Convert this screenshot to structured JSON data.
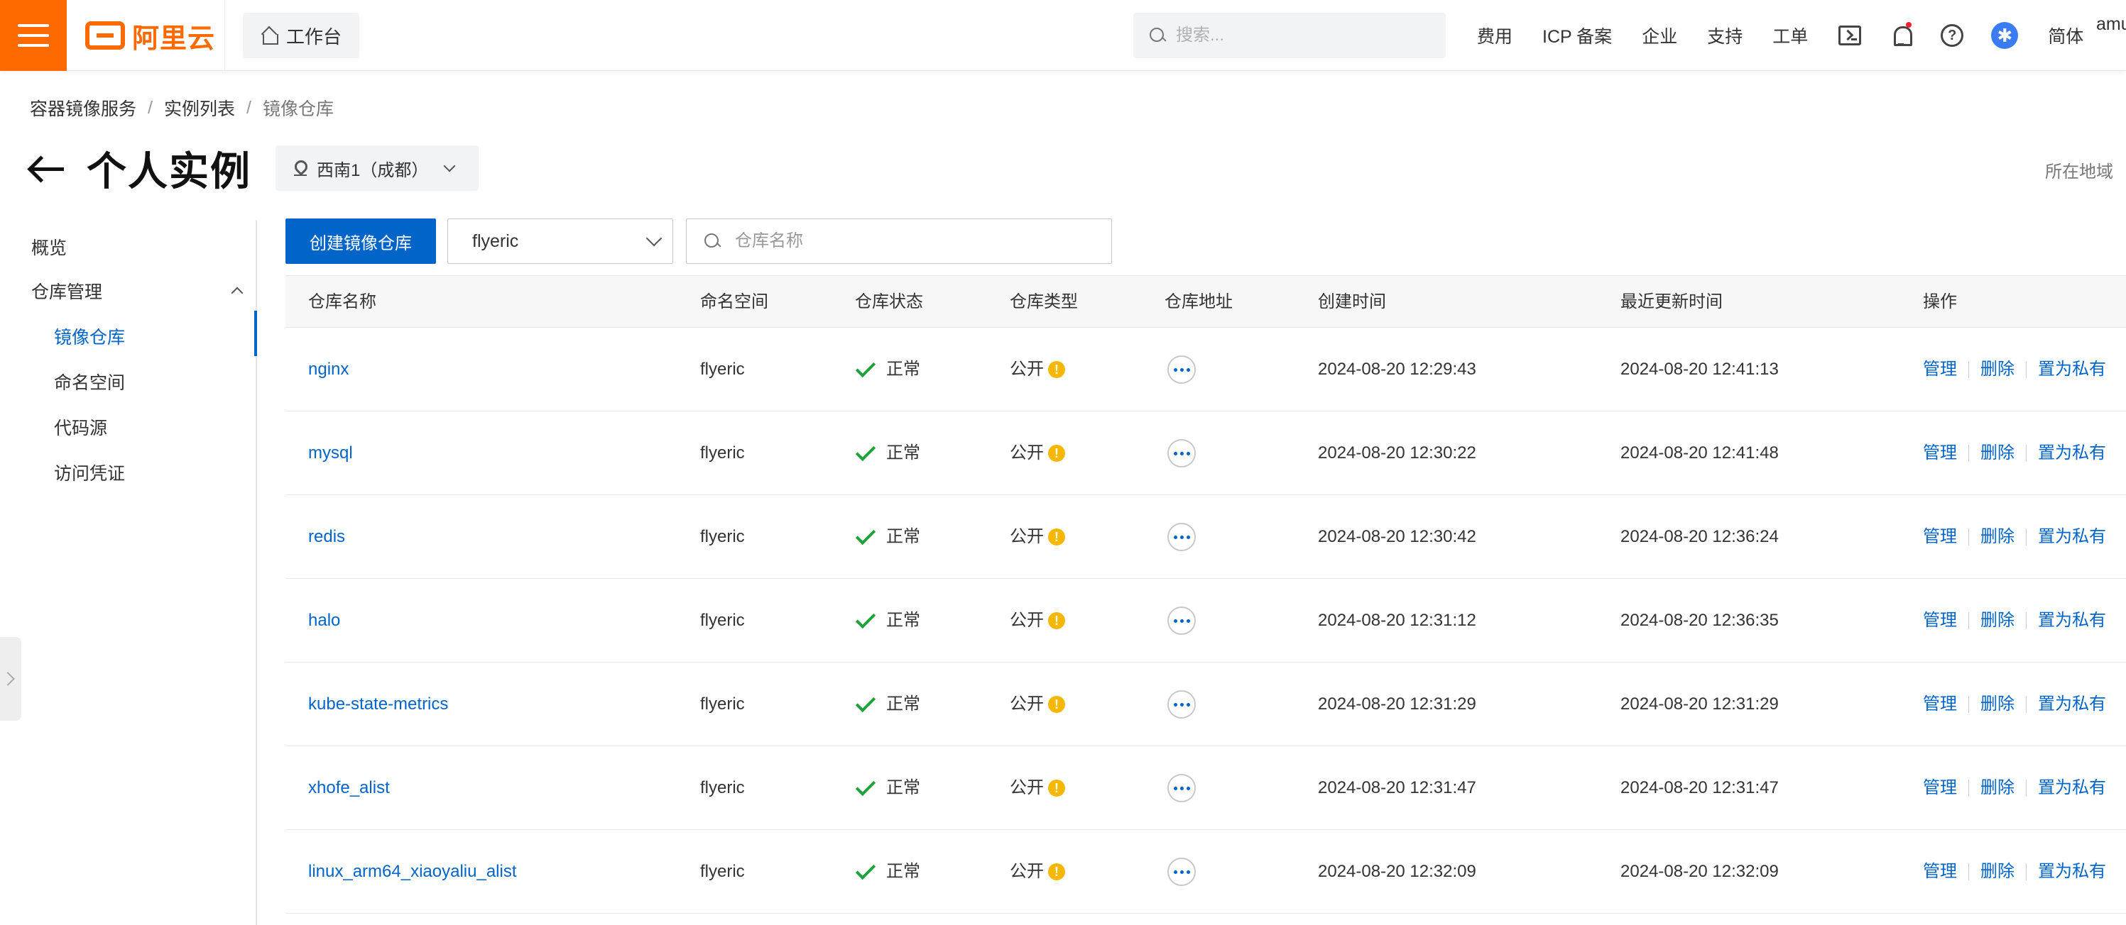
{
  "topbar": {
    "logo_text": "阿里云",
    "workbench_label": "工作台",
    "search_placeholder": "搜索...",
    "links": [
      "费用",
      "ICP 备案",
      "企业",
      "支持",
      "工单"
    ],
    "user_lang": "简体",
    "user_name": "amu",
    "brand_color": "#ff6a00"
  },
  "breadcrumb": [
    "容器镜像服务",
    "实例列表",
    "镜像仓库"
  ],
  "page": {
    "title": "个人实例",
    "region": "西南1（成都）",
    "region_hint": "所在地域"
  },
  "sidebar": {
    "overview": "概览",
    "group_label": "仓库管理",
    "sub_items": [
      "镜像仓库",
      "命名空间",
      "代码源",
      "访问凭证"
    ],
    "active_index": 0
  },
  "toolbar": {
    "create_button": "创建镜像仓库",
    "namespace_value": "flyeric",
    "repo_search_placeholder": "仓库名称"
  },
  "table": {
    "columns": [
      "仓库名称",
      "命名空间",
      "仓库状态",
      "仓库类型",
      "仓库地址",
      "创建时间",
      "最近更新时间",
      "操作"
    ],
    "rows": [
      {
        "name": "nginx",
        "namespace": "flyeric",
        "status": "正常",
        "type": "公开",
        "created": "2024-08-20 12:29:43",
        "updated": "2024-08-20 12:41:13"
      },
      {
        "name": "mysql",
        "namespace": "flyeric",
        "status": "正常",
        "type": "公开",
        "created": "2024-08-20 12:30:22",
        "updated": "2024-08-20 12:41:48"
      },
      {
        "name": "redis",
        "namespace": "flyeric",
        "status": "正常",
        "type": "公开",
        "created": "2024-08-20 12:30:42",
        "updated": "2024-08-20 12:36:24"
      },
      {
        "name": "halo",
        "namespace": "flyeric",
        "status": "正常",
        "type": "公开",
        "created": "2024-08-20 12:31:12",
        "updated": "2024-08-20 12:36:35"
      },
      {
        "name": "kube-state-metrics",
        "namespace": "flyeric",
        "status": "正常",
        "type": "公开",
        "created": "2024-08-20 12:31:29",
        "updated": "2024-08-20 12:31:29"
      },
      {
        "name": "xhofe_alist",
        "namespace": "flyeric",
        "status": "正常",
        "type": "公开",
        "created": "2024-08-20 12:31:47",
        "updated": "2024-08-20 12:31:47"
      },
      {
        "name": "linux_arm64_xiaoyaliu_alist",
        "namespace": "flyeric",
        "status": "正常",
        "type": "公开",
        "created": "2024-08-20 12:32:09",
        "updated": "2024-08-20 12:32:09"
      }
    ],
    "actions": [
      "管理",
      "删除",
      "置为私有"
    ]
  }
}
